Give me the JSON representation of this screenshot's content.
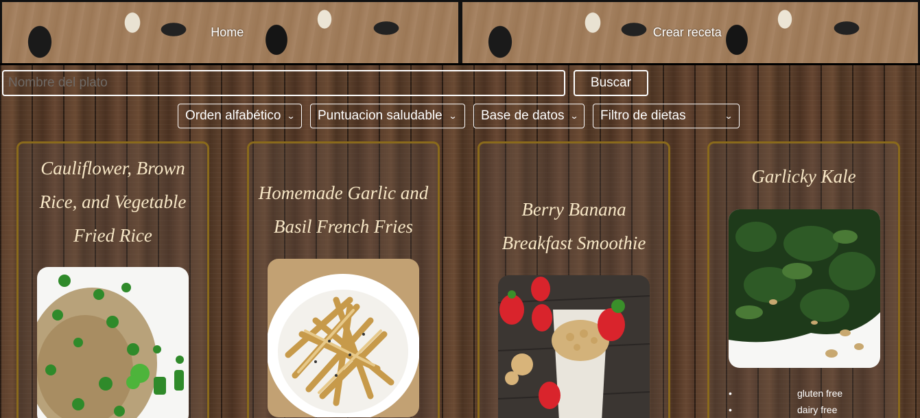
{
  "nav": {
    "home_label": "Home",
    "create_label": "Crear receta"
  },
  "search": {
    "placeholder": "Nombre del plato",
    "value": "",
    "button_label": "Buscar"
  },
  "filters": [
    {
      "label": "Orden alfabético"
    },
    {
      "label": "Puntuacion saludable"
    },
    {
      "label": "Base de datos"
    },
    {
      "label": "Filtro de dietas"
    }
  ],
  "cards": [
    {
      "title": "Cauliflower, Brown Rice, and Vegetable Fried Rice",
      "image": "fried-rice-photo",
      "diets": []
    },
    {
      "title": "Homemade Garlic and Basil French Fries",
      "image": "french-fries-photo",
      "diets": []
    },
    {
      "title": "Berry Banana Breakfast Smoothie",
      "image": "smoothie-photo",
      "diets": []
    },
    {
      "title": "Garlicky Kale",
      "image": "kale-photo",
      "diets": [
        "gluten free",
        "dairy free"
      ]
    }
  ],
  "colors": {
    "card_border": "#8a6a1b",
    "title_text": "#f7e7c6",
    "wood": "#5a3e2b"
  }
}
